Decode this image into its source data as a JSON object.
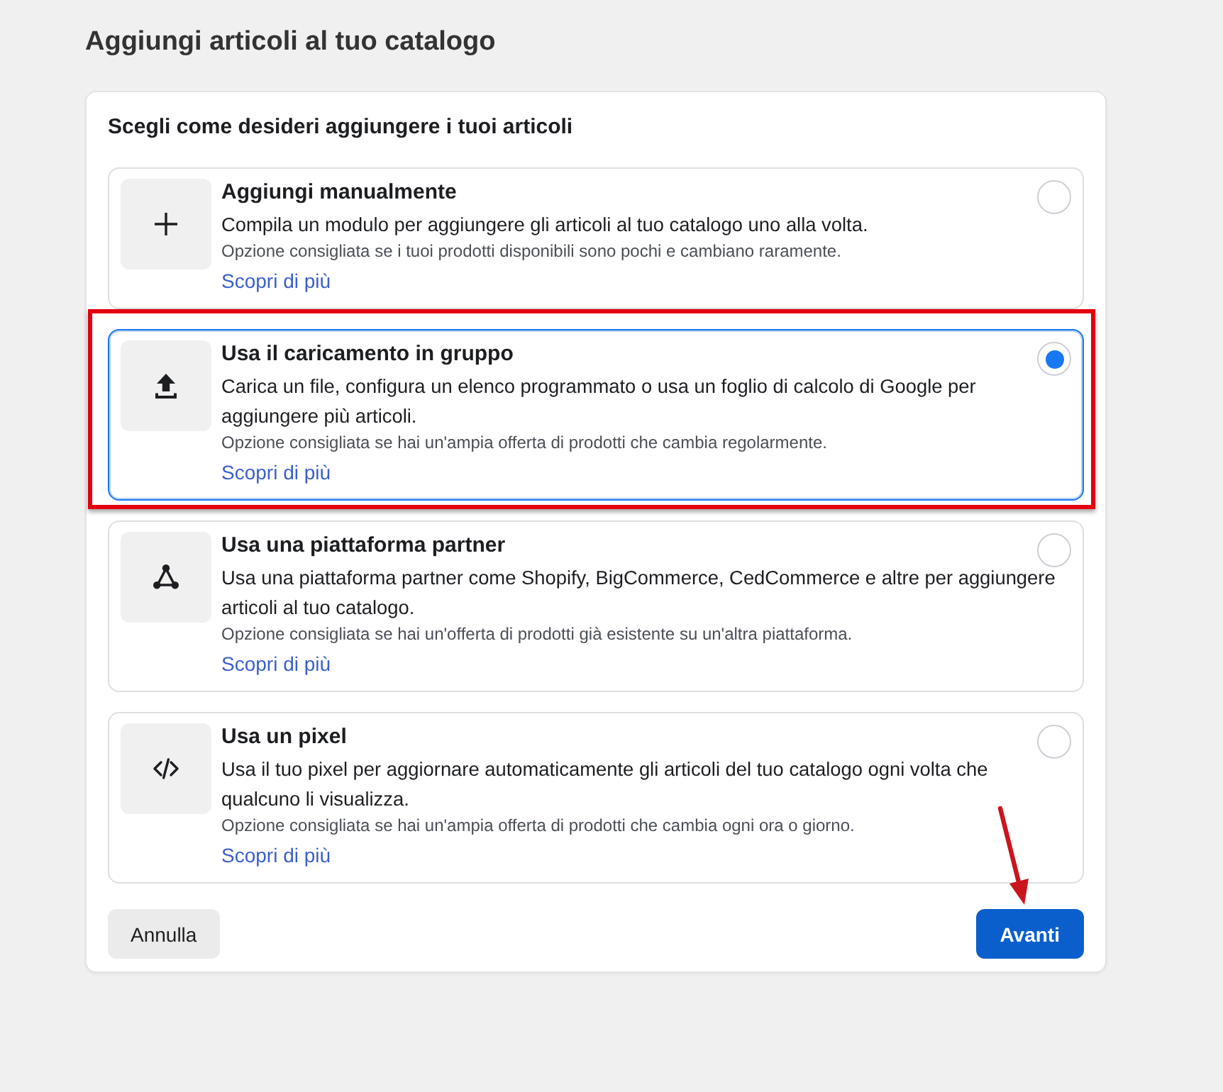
{
  "page": {
    "title": "Aggiungi articoli al tuo catalogo"
  },
  "card": {
    "heading": "Scegli come desideri aggiungere i tuoi articoli",
    "options": [
      {
        "kind": "manual",
        "title": "Aggiungi manualmente",
        "description": "Compila un modulo per aggiungere gli articoli al tuo catalogo uno alla volta.",
        "hint": "Opzione consigliata se i tuoi prodotti disponibili sono pochi e cambiano raramente.",
        "link": "Scopri di più",
        "selected": false,
        "highlighted": false
      },
      {
        "kind": "bulk-upload",
        "title": "Usa il caricamento in gruppo",
        "description": "Carica un file, configura un elenco programmato o usa un foglio di calcolo di Google per aggiungere più articoli.",
        "hint": "Opzione consigliata se hai un'ampia offerta di prodotti che cambia regolarmente.",
        "link": "Scopri di più",
        "selected": true,
        "highlighted": true
      },
      {
        "kind": "partner",
        "title": "Usa una piattaforma partner",
        "description": "Usa una piattaforma partner come Shopify, BigCommerce, CedCommerce e altre per aggiungere articoli al tuo catalogo.",
        "hint": "Opzione consigliata se hai un'offerta di prodotti già esistente su un'altra piattaforma.",
        "link": "Scopri di più",
        "selected": false,
        "highlighted": false
      },
      {
        "kind": "pixel",
        "title": "Usa un pixel",
        "description": "Usa il tuo pixel per aggiornare automaticamente gli articoli del tuo catalogo ogni volta che qualcuno li visualizza.",
        "hint": "Opzione consigliata se hai un'ampia offerta di prodotti che cambia ogni ora o giorno.",
        "link": "Scopri di più",
        "selected": false,
        "highlighted": false
      }
    ]
  },
  "footer": {
    "cancel_button": "Annulla",
    "next_button": {
      "label": "Avanti",
      "pointed_at": true
    }
  }
}
